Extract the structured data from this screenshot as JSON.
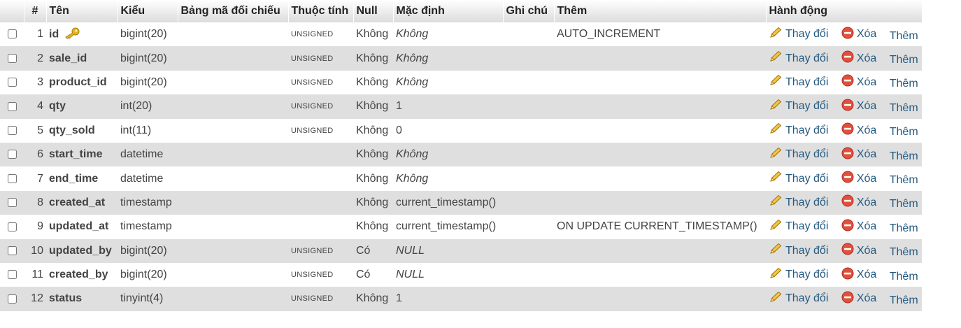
{
  "columns": {
    "check": "",
    "num": "#",
    "name": "Tên",
    "type": "Kiểu",
    "collation": "Bảng mã đối chiếu",
    "attributes": "Thuộc tính",
    "null": "Null",
    "default": "Mặc định",
    "comments": "Ghi chú",
    "extra": "Thêm",
    "action": "Hành động"
  },
  "actions": {
    "change": "Thay đổi",
    "drop": "Xóa",
    "more": "Thêm"
  },
  "icons": {
    "primary_key": "key-icon",
    "change": "pencil-icon",
    "drop": "drop-icon"
  },
  "rows": [
    {
      "num": "1",
      "name": "id",
      "type": "bigint(20)",
      "collation": "",
      "attributes": "UNSIGNED",
      "null": "Không",
      "default": "Không",
      "default_italic": true,
      "comments": "",
      "extra": "AUTO_INCREMENT",
      "primary_key": true
    },
    {
      "num": "2",
      "name": "sale_id",
      "type": "bigint(20)",
      "collation": "",
      "attributes": "UNSIGNED",
      "null": "Không",
      "default": "Không",
      "default_italic": true,
      "comments": "",
      "extra": ""
    },
    {
      "num": "3",
      "name": "product_id",
      "type": "bigint(20)",
      "collation": "",
      "attributes": "UNSIGNED",
      "null": "Không",
      "default": "Không",
      "default_italic": true,
      "comments": "",
      "extra": ""
    },
    {
      "num": "4",
      "name": "qty",
      "type": "int(20)",
      "collation": "",
      "attributes": "UNSIGNED",
      "null": "Không",
      "default": "1",
      "default_italic": false,
      "comments": "",
      "extra": ""
    },
    {
      "num": "5",
      "name": "qty_sold",
      "type": "int(11)",
      "collation": "",
      "attributes": "UNSIGNED",
      "null": "Không",
      "default": "0",
      "default_italic": false,
      "comments": "",
      "extra": ""
    },
    {
      "num": "6",
      "name": "start_time",
      "type": "datetime",
      "collation": "",
      "attributes": "",
      "null": "Không",
      "default": "Không",
      "default_italic": true,
      "comments": "",
      "extra": ""
    },
    {
      "num": "7",
      "name": "end_time",
      "type": "datetime",
      "collation": "",
      "attributes": "",
      "null": "Không",
      "default": "Không",
      "default_italic": true,
      "comments": "",
      "extra": ""
    },
    {
      "num": "8",
      "name": "created_at",
      "type": "timestamp",
      "collation": "",
      "attributes": "",
      "null": "Không",
      "default": "current_timestamp()",
      "default_italic": false,
      "comments": "",
      "extra": ""
    },
    {
      "num": "9",
      "name": "updated_at",
      "type": "timestamp",
      "collation": "",
      "attributes": "",
      "null": "Không",
      "default": "current_timestamp()",
      "default_italic": false,
      "comments": "",
      "extra": "ON UPDATE CURRENT_TIMESTAMP()"
    },
    {
      "num": "10",
      "name": "updated_by",
      "type": "bigint(20)",
      "collation": "",
      "attributes": "UNSIGNED",
      "null": "Có",
      "default": "NULL",
      "default_italic": true,
      "comments": "",
      "extra": ""
    },
    {
      "num": "11",
      "name": "created_by",
      "type": "bigint(20)",
      "collation": "",
      "attributes": "UNSIGNED",
      "null": "Có",
      "default": "NULL",
      "default_italic": true,
      "comments": "",
      "extra": ""
    },
    {
      "num": "12",
      "name": "status",
      "type": "tinyint(4)",
      "collation": "",
      "attributes": "UNSIGNED",
      "null": "Không",
      "default": "1",
      "default_italic": false,
      "comments": "",
      "extra": ""
    }
  ]
}
